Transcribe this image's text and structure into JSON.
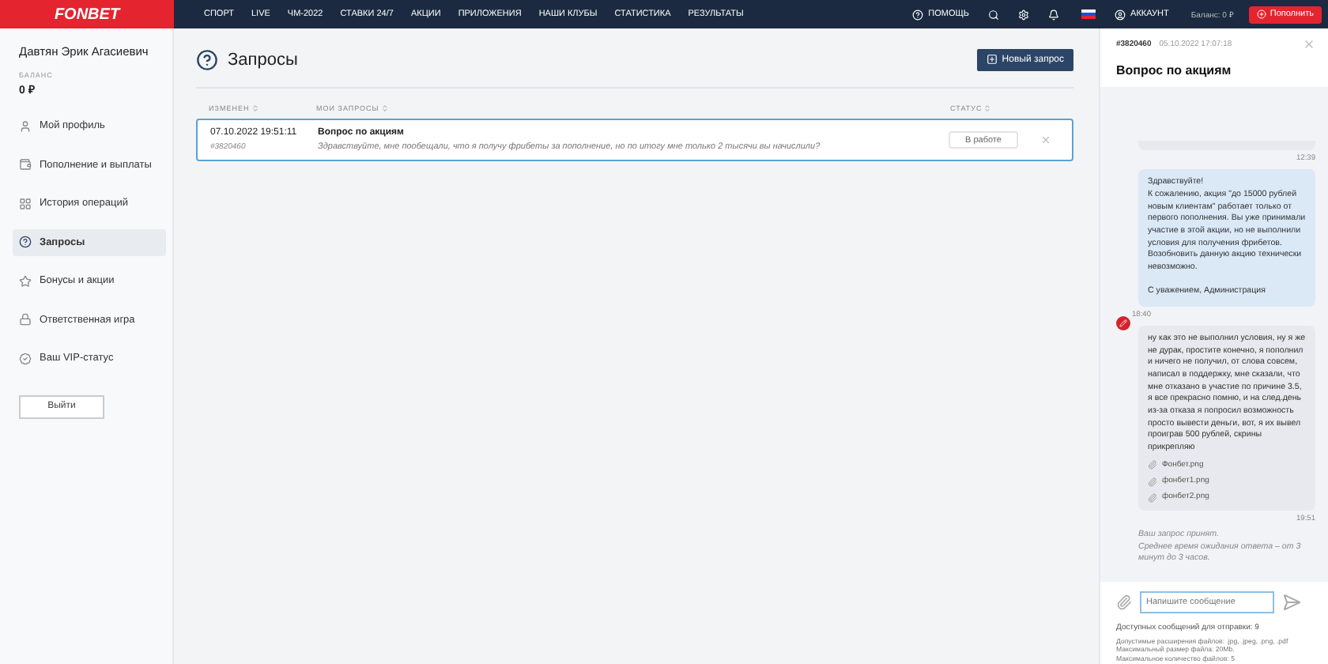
{
  "topbar": {
    "logo": "FONBET",
    "nav": [
      {
        "label": "СПОРТ"
      },
      {
        "label": "LIVE"
      },
      {
        "label": "ЧМ-2022"
      },
      {
        "label": "СТАВКИ 24/7"
      },
      {
        "label": "АКЦИИ"
      },
      {
        "label": "ПРИЛОЖЕНИЯ"
      },
      {
        "label": "НАШИ КЛУБЫ"
      },
      {
        "label": "СТАТИСТИКА"
      },
      {
        "label": "РЕЗУЛЬТАТЫ"
      }
    ],
    "help": "ПОМОЩЬ",
    "account": "АККАУНТ",
    "balance": "Баланс: 0 ₽",
    "deposit": "Пополнить"
  },
  "sidebar": {
    "user": "Давтян Эрик Агасиевич",
    "balance_label": "БАЛАНС",
    "balance": "0 ₽",
    "items": [
      {
        "label": "Мой профиль",
        "selected": false
      },
      {
        "label": "Пополнение и выплаты",
        "selected": false
      },
      {
        "label": "История операций",
        "selected": false
      },
      {
        "label": "Запросы",
        "selected": true
      },
      {
        "label": "Бонусы и акции",
        "selected": false
      },
      {
        "label": "Ответственная игра",
        "selected": false
      },
      {
        "label": "Ваш VIP-статус",
        "selected": false
      }
    ],
    "logout": "Выйти"
  },
  "main": {
    "title": "Запросы",
    "new_button": "Новый запрос",
    "columns": [
      "ИЗМЕНЕН",
      "МОИ ЗАПРОСЫ",
      "СТАТУС"
    ],
    "rows": [
      {
        "date": "07.10.2022 19:51:11",
        "id": "#3820460",
        "subject": "Вопрос по акциям",
        "preview": "Здравствуйте, мне пообещали, что я получу фрибеты за пополнение, но по итогу мне только 2 тысячи вы начислили?",
        "status": "В работе",
        "selected": true
      }
    ]
  },
  "chat": {
    "id": "#3820460",
    "date": "05.10.2022 17:07:18",
    "title": "Вопрос по акциям",
    "messages": [
      {
        "kind": "outgoing",
        "time": "12:39"
      },
      {
        "kind": "incoming",
        "text": "Здравствуйте!\nК сожалению, акция \"до 15000 рублей новым клиентам\" работает только от первого пополнения. Вы уже принимали участие в этой акции, но не выполнили условия для получения фрибетов. Возобновить данную акцию технически невозможно.\n\nС уважением, Администрация",
        "time": "18:40"
      },
      {
        "kind": "outgoing",
        "text": "ну как это не выполнил условия, ну я же не дурак, простите конечно, я пополнил и ничего не получил, от слова совсем, написал в поддержку, мне сказали, что мне отказано в участие по причине 3.5, я все прекрасно помню, и на след.день из-за отказа я попросил возможность просто вывести деньги, вот, я их вывел проиграв 500 рублей, скрины прикрепляю",
        "attachments": [
          "Фонбет.png",
          "фонбет1.png",
          "фонбет2.png"
        ],
        "time": "19:51"
      },
      {
        "kind": "notice",
        "text": "Ваш запрос принят.\nСреднее время ожидания ответа – от 3 минут до 3 часов."
      }
    ],
    "input_placeholder": "Напишите сообщение",
    "remaining": "Доступных сообщений для отправки: 9",
    "rules": [
      "Допустимые расширения файлов: .jpg, .jpeg, .png, .pdf",
      "Максимальный размер файла: 20Mb.",
      "Максимальное количество файлов: 5"
    ]
  }
}
